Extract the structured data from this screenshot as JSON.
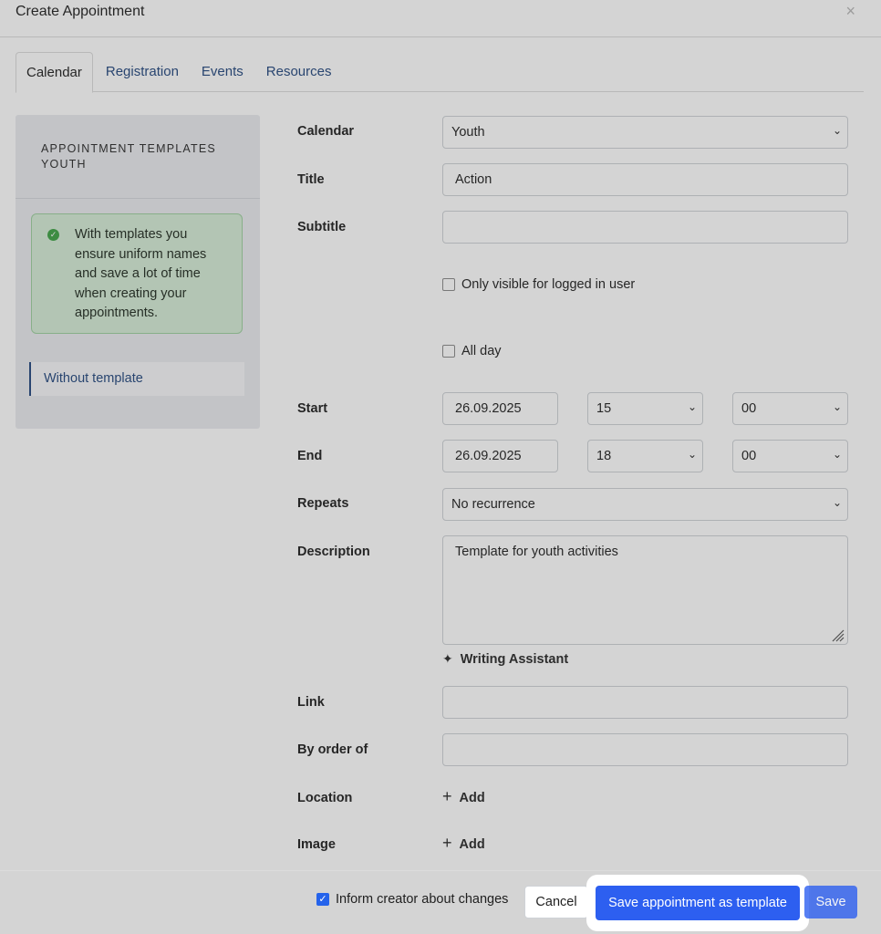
{
  "modal": {
    "title": "Create Appointment",
    "close_glyph": "×"
  },
  "tabs": [
    {
      "label": "Calendar",
      "active": true
    },
    {
      "label": "Registration",
      "active": false
    },
    {
      "label": "Events",
      "active": false
    },
    {
      "label": "Resources",
      "active": false
    }
  ],
  "sidebar": {
    "heading_line1": "APPOINTMENT TEMPLATES",
    "heading_line2": "YOUTH",
    "info_text": "With templates you ensure uniform names and save a lot of time when creating your appointments.",
    "template_item": "Without template"
  },
  "form": {
    "calendar": {
      "label": "Calendar",
      "value": "Youth"
    },
    "title": {
      "label": "Title",
      "value": "Action"
    },
    "subtitle": {
      "label": "Subtitle",
      "value": ""
    },
    "only_visible": {
      "label": "Only visible for logged in user",
      "checked": false
    },
    "all_day": {
      "label": "All day",
      "checked": false
    },
    "start": {
      "label": "Start",
      "date": "26.09.2025",
      "hour": "15",
      "minute": "00"
    },
    "end": {
      "label": "End",
      "date": "26.09.2025",
      "hour": "18",
      "minute": "00"
    },
    "repeats": {
      "label": "Repeats",
      "value": "No recurrence"
    },
    "description": {
      "label": "Description",
      "value": "Template for youth activities"
    },
    "writing_assistant": "Writing Assistant",
    "link": {
      "label": "Link",
      "value": ""
    },
    "by_order_of": {
      "label": "By order of",
      "value": ""
    },
    "location": {
      "label": "Location",
      "add": "Add"
    },
    "image": {
      "label": "Image",
      "add": "Add"
    }
  },
  "footer": {
    "inform_label": "Inform creator about changes",
    "inform_checked": true,
    "cancel": "Cancel",
    "save_template": "Save appointment as template",
    "save": "Save"
  },
  "colors": {
    "primary": "#2d5ff0",
    "link": "#24487f",
    "info_bg": "#d5ecd6"
  }
}
